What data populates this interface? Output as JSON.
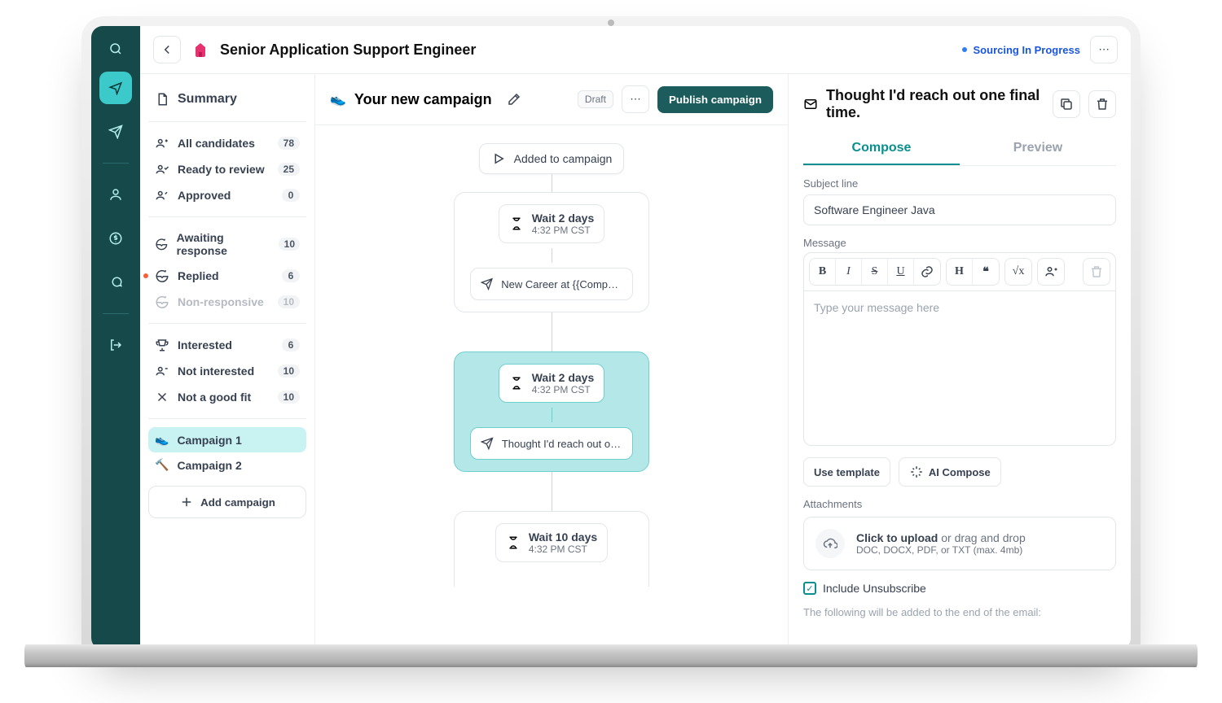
{
  "header": {
    "job_title": "Senior Application Support Engineer",
    "status": "Sourcing In Progress"
  },
  "sidebar": {
    "summary": "Summary",
    "all": {
      "label": "All candidates",
      "count": "78"
    },
    "ready": {
      "label": "Ready to review",
      "count": "25"
    },
    "approved": {
      "label": "Approved",
      "count": "0"
    },
    "awaiting": {
      "label": "Awaiting response",
      "count": "10"
    },
    "replied": {
      "label": "Replied",
      "count": "6"
    },
    "nonresp": {
      "label": "Non-responsive",
      "count": "10"
    },
    "interested": {
      "label": "Interested",
      "count": "6"
    },
    "not_interested": {
      "label": "Not interested",
      "count": "10"
    },
    "not_fit": {
      "label": "Not a good fit",
      "count": "10"
    },
    "camp1": "Campaign 1",
    "camp2": "Campaign 2",
    "add_campaign": "Add campaign"
  },
  "canvas": {
    "title": "Your new campaign",
    "badge": "Draft",
    "publish": "Publish campaign",
    "added": "Added to campaign",
    "s1_wait": "Wait 2 days",
    "s1_time": "4:32 PM CST",
    "s1_msg": "New Career at {{Company N...",
    "s2_wait": "Wait 2 days",
    "s2_time": "4:32 PM CST",
    "s2_msg": "Thought I'd reach out one fi...",
    "s3_wait": "Wait 10 days",
    "s3_time": "4:32 PM CST"
  },
  "editor": {
    "title": "Thought I'd reach out one final time.",
    "tab_compose": "Compose",
    "tab_preview": "Preview",
    "subject_label": "Subject line",
    "subject_value": "Software Engineer Java",
    "message_label": "Message",
    "placeholder": "Type your message here",
    "use_template": "Use template",
    "ai_compose": "AI Compose",
    "attachments_label": "Attachments",
    "upload_main": "Click to upload",
    "upload_rest": " or drag and drop",
    "upload_sub": "DOC, DOCX, PDF, or TXT (max. 4mb)",
    "unsubscribe": "Include Unsubscribe",
    "unsubscribe_note": "The following will be added to the end of the email:"
  }
}
